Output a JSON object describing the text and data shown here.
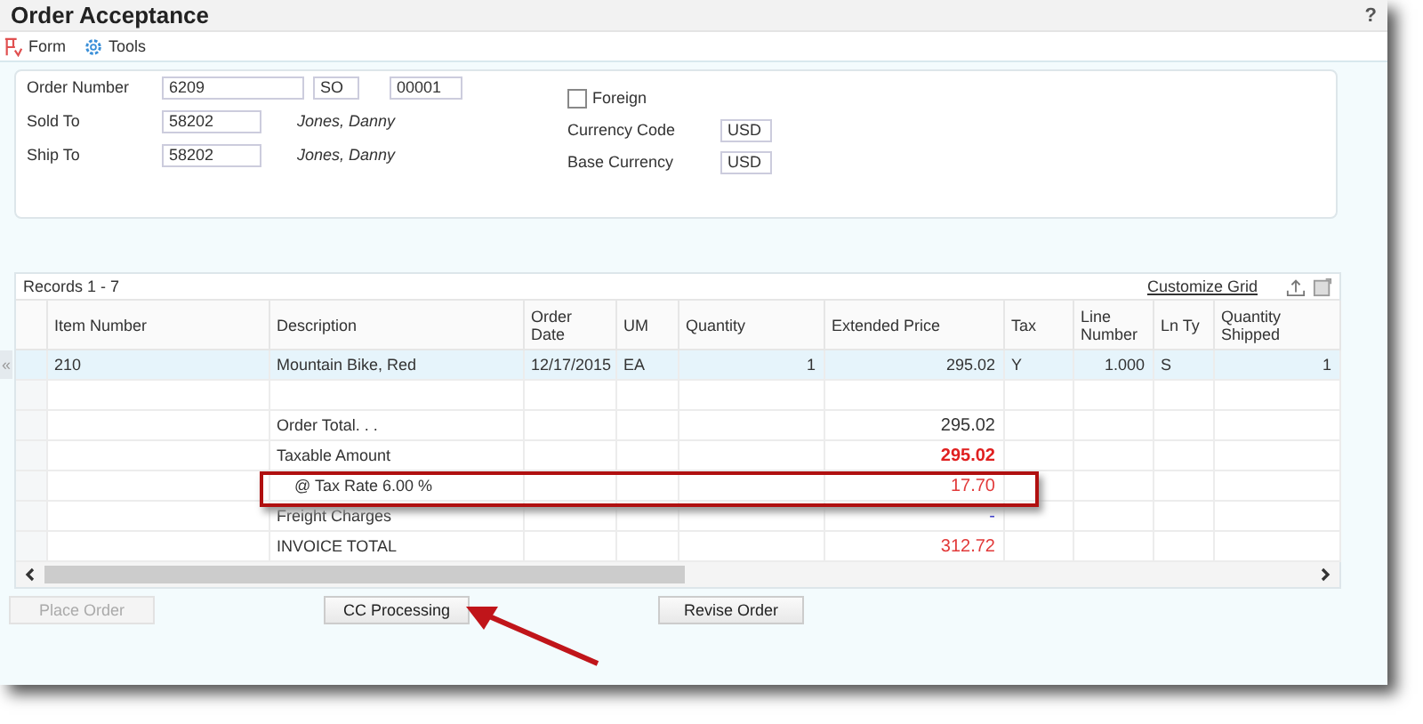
{
  "window": {
    "title": "Order Acceptance",
    "help": "?"
  },
  "toolbar": [
    {
      "label": "Form"
    },
    {
      "label": "Tools"
    }
  ],
  "header": {
    "order_number": {
      "label": "Order Number",
      "values": [
        "6209",
        "SO",
        "00001"
      ]
    },
    "sold_to": {
      "label": "Sold To",
      "value": "58202",
      "name": "Jones, Danny"
    },
    "ship_to": {
      "label": "Ship To",
      "value": "58202",
      "name": "Jones, Danny"
    },
    "foreign": {
      "label": "Foreign",
      "checked": false
    },
    "currency_code": {
      "label": "Currency Code",
      "value": "USD"
    },
    "base_currency": {
      "label": "Base Currency",
      "value": "USD"
    }
  },
  "grid": {
    "records": "Records 1 - 7",
    "customize": "Customize Grid",
    "collapse": "«",
    "columns": [
      "Item Number",
      "Description",
      "Order Date",
      "UM",
      "Quantity",
      "Extended Price",
      "Tax",
      "Line Number",
      "Ln Ty",
      "Quantity Shipped"
    ],
    "rows": [
      {
        "kind": "item",
        "selected": true,
        "item": "210",
        "description": "Mountain Bike, Red",
        "order_date": "12/17/2015",
        "um": "EA",
        "quantity": "1",
        "price": "295.02",
        "tax": "Y",
        "line": "1.000",
        "ln_ty": "S",
        "shipped": "1"
      },
      {
        "kind": "blank",
        "selected": false
      },
      {
        "kind": "summary",
        "selected": false,
        "description": "Order Total. . .",
        "amount": "295.02",
        "color": "#333333",
        "bold": false,
        "highlighted": false
      },
      {
        "kind": "summary",
        "selected": false,
        "description": "Taxable Amount",
        "amount": "295.02",
        "color": "#e02020",
        "bold": true,
        "highlighted": false
      },
      {
        "kind": "summary",
        "selected": false,
        "description": "@ Tax Rate 6.00 %",
        "amount": "17.70",
        "color": "#e23a3a",
        "bold": false,
        "highlighted": true
      },
      {
        "kind": "summary",
        "selected": false,
        "description": "Freight Charges",
        "amount": "-",
        "link": true,
        "bold": false,
        "highlighted": false
      },
      {
        "kind": "summary",
        "selected": false,
        "description": "INVOICE TOTAL",
        "amount": "312.72",
        "color": "#e23a3a",
        "bold": false,
        "highlighted": false
      }
    ]
  },
  "buttons": [
    {
      "label": "Place Order",
      "disabled": true,
      "pointed": false
    },
    {
      "label": "CC Processing",
      "disabled": false,
      "pointed": true
    },
    {
      "label": "Revise Order",
      "disabled": false,
      "pointed": false
    }
  ]
}
